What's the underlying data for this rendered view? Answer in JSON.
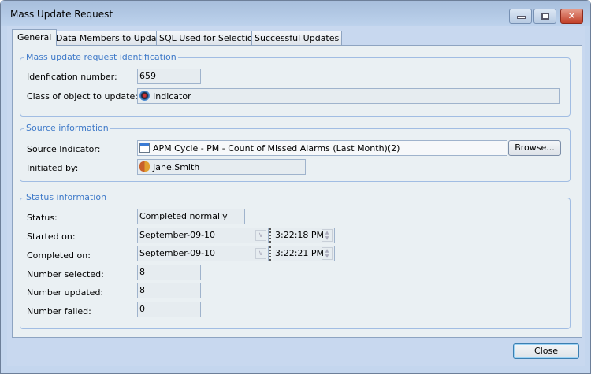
{
  "window": {
    "title": "Mass Update Request"
  },
  "tabs": [
    {
      "label": "General"
    },
    {
      "label": "Data Members to Update"
    },
    {
      "label": "SQL Used for Selection"
    },
    {
      "label": "Successful Updates"
    }
  ],
  "identification": {
    "title": "Mass update request identification",
    "id_label": "Idenfication number:",
    "id_value": "659",
    "class_label": "Class of object to update:",
    "class_value": "Indicator"
  },
  "source": {
    "title": "Source information",
    "indicator_label": "Source Indicator:",
    "indicator_value": "APM Cycle - PM - Count of Missed Alarms (Last Month)(2)",
    "browse": "Browse...",
    "initiated_label": "Initiated by:",
    "initiated_value": "Jane.Smith"
  },
  "status": {
    "title": "Status information",
    "status_label": "Status:",
    "status_value": "Completed normally",
    "started_label": "Started on:",
    "started_date": "September-09-10",
    "started_time": "3:22:18 PM",
    "completed_label": "Completed on:",
    "completed_date": "September-09-10",
    "completed_time": "3:22:21 PM",
    "selected_label": "Number selected:",
    "selected_value": "8",
    "updated_label": "Number updated:",
    "updated_value": "8",
    "failed_label": "Number failed:",
    "failed_value": "0"
  },
  "footer": {
    "close": "Close"
  }
}
